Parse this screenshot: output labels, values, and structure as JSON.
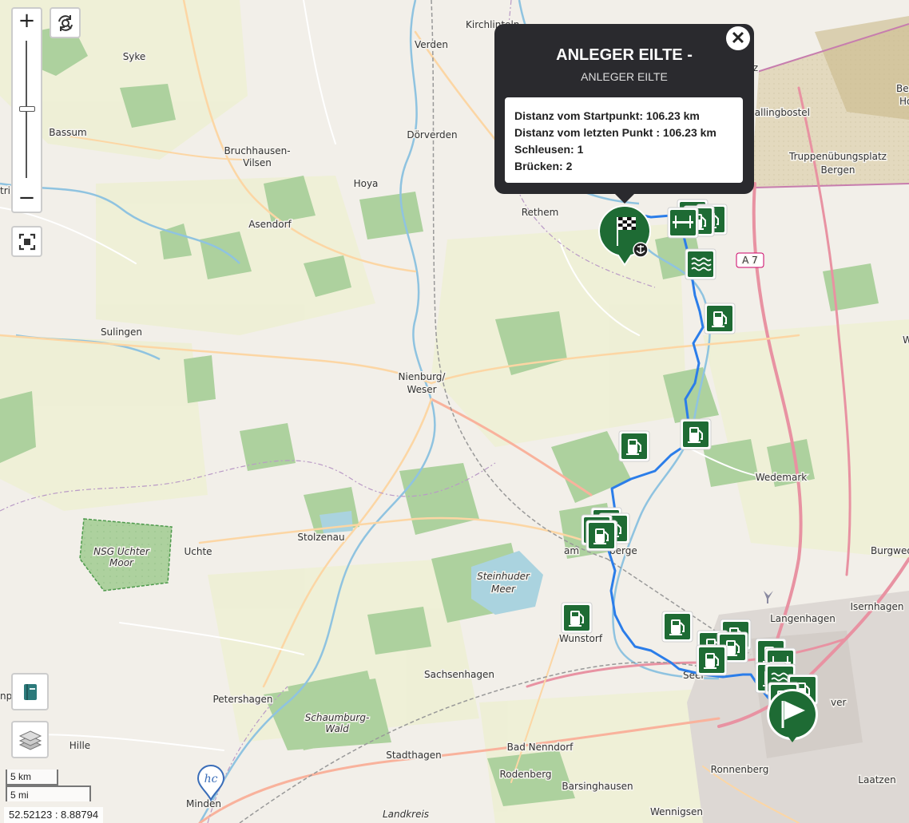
{
  "map": {
    "places": [
      {
        "name": "Kirchlinteln"
      },
      {
        "name": "Verden"
      },
      {
        "name": "Syke"
      },
      {
        "name": "Bassum"
      },
      {
        "name": "Dörverden"
      },
      {
        "name": "Bruchhausen-"
      },
      {
        "name": "Vilsen"
      },
      {
        "name": "Hoya"
      },
      {
        "name": "Asendorf"
      },
      {
        "name": "Rethem"
      },
      {
        "name": "allingbostel"
      },
      {
        "name": "Truppenübungsplatz"
      },
      {
        "name": "Bergen"
      },
      {
        "name": "A 7"
      },
      {
        "name": "Sulingen"
      },
      {
        "name": "Nienburg/"
      },
      {
        "name": "Weser"
      },
      {
        "name": "Wedemark"
      },
      {
        "name": "NSG Uchter"
      },
      {
        "name": "Moor"
      },
      {
        "name": "Uchte"
      },
      {
        "name": "Stolzenau"
      },
      {
        "name": "am"
      },
      {
        "name": "berge"
      },
      {
        "name": "Steinhuder"
      },
      {
        "name": "Meer"
      },
      {
        "name": "Burgwed"
      },
      {
        "name": "Isernhagen"
      },
      {
        "name": "Langenhagen"
      },
      {
        "name": "Wunstorf"
      },
      {
        "name": "Sachsenhagen"
      },
      {
        "name": "Seel"
      },
      {
        "name": "ver"
      },
      {
        "name": "Petershagen"
      },
      {
        "name": "Schaumburg-"
      },
      {
        "name": "Wald"
      },
      {
        "name": "Hille"
      },
      {
        "name": "Stadthagen"
      },
      {
        "name": "Bad Nenndorf"
      },
      {
        "name": "Rodenberg"
      },
      {
        "name": "Ronnenberg"
      },
      {
        "name": "Barsinghausen"
      },
      {
        "name": "Wennigsen"
      },
      {
        "name": "Laatzen"
      },
      {
        "name": "Minden"
      },
      {
        "name": "Landkreis"
      },
      {
        "name": "Beck"
      },
      {
        "name": "Ho"
      },
      {
        "name": "tz"
      },
      {
        "name": "Wi"
      },
      {
        "name": "np"
      },
      {
        "name": "tri"
      }
    ]
  },
  "controls": {
    "zoom_in": "+",
    "zoom_out": "−"
  },
  "scale": {
    "km": "5 km",
    "mi": "5 mi"
  },
  "coords": "52.52123 : 8.88794",
  "popup": {
    "title": "ANLEGER EILTE -",
    "subtitle": "ANLEGER EILTE",
    "lines": [
      "Distanz vom Startpunkt: 106.23 km",
      "Distanz vom letzten Punkt : 106.23 km",
      "Schleusen: 1",
      "Brücken: 2"
    ],
    "close": "✕"
  },
  "colors": {
    "route": "#2b7de9",
    "marker_green": "#1e6b34",
    "popup_bg": "#2a2a2e"
  },
  "markers": {
    "start": "flag-icon",
    "end": "checkered-flag-icon",
    "fuel": "fuel-pump-icon",
    "bridge": "bridge-icon",
    "lock": "waves-icon",
    "logo": "hc"
  }
}
